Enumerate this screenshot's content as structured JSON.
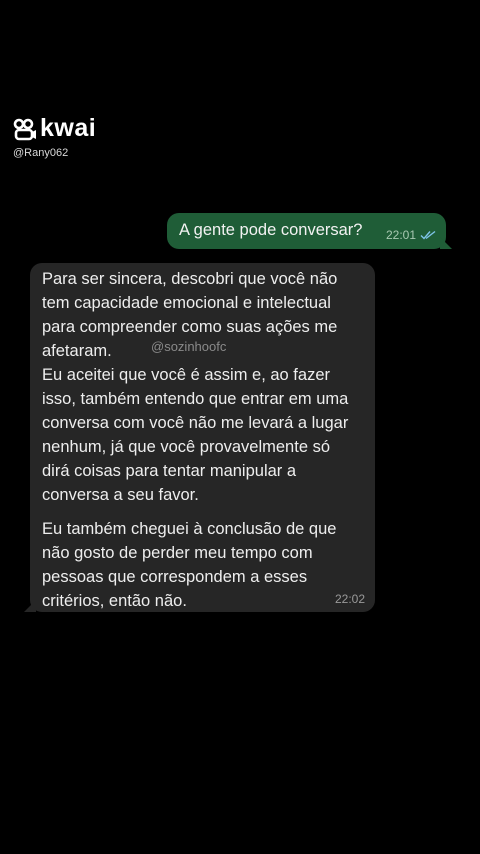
{
  "watermark": {
    "brand": "kwai",
    "handle": "@Rany062",
    "overlay_handle": "@sozinhoofc"
  },
  "messages": {
    "outgoing": {
      "text": "A gente pode conversar?",
      "time": "22:01",
      "status_icon": "double-check-read-icon"
    },
    "incoming": {
      "lines": [
        "Para ser sincera, descobri que você não",
        "tem capacidade emocional e intelectual",
        "para compreender como suas ações me",
        "afetaram.",
        "Eu aceitei que você é assim e, ao fazer",
        "isso, também entendo que entrar em uma",
        "conversa com você não me levará a lugar",
        "nenhum, já que você provavelmente só",
        "dirá coisas para tentar manipular a",
        "conversa a seu favor.",
        "Eu também cheguei à conclusão de que",
        "não gosto de perder meu tempo com",
        "pessoas que correspondem a esses",
        "critérios, então não."
      ],
      "time": "22:02"
    }
  },
  "colors": {
    "background": "#000000",
    "outgoing_bubble": "#1f5d37",
    "incoming_bubble": "#262626",
    "read_ticks": "#7fc4e8"
  }
}
